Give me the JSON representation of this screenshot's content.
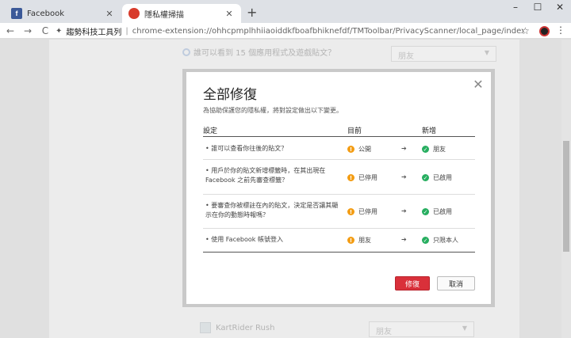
{
  "tabs": [
    {
      "label": "Facebook",
      "favicon": "f",
      "active": false
    },
    {
      "label": "隱私權掃描",
      "active": true
    }
  ],
  "window": {
    "minimize": "–",
    "maximize": "☐",
    "close": "✕"
  },
  "toolbar": {
    "back": "←",
    "forward": "→",
    "reload": "C",
    "extension_icon": "✦",
    "origin": "趨勢科技工具列",
    "separator": "|",
    "url": "chrome-extension://ohhcpmplhhiiaoiddkfboafbhiknefdf/TMToolbar/PrivacyScanner/local_page/index.html?locale=z...",
    "star": "☆",
    "menu": "⋮"
  },
  "background": {
    "row_text": "誰可以看到 15 個應用程式及遊戲貼文？",
    "select_value_top": "朋友",
    "game_name": "KartRider Rush",
    "select_value_bottom": "朋友",
    "select_arrow": "▼"
  },
  "modal": {
    "close": "✕",
    "title": "全部修復",
    "description": "為協助保護您的隱私權，將對設定做出以下變更。",
    "headers": {
      "setting": "設定",
      "current": "目前",
      "new": "新增"
    },
    "rows": [
      {
        "setting": "誰可以查看你往後的貼文？",
        "current": "公開",
        "new": "朋友"
      },
      {
        "setting": "用戶於你的貼文新增標籤時，在其出現在 Facebook 之前先審查標籤？",
        "current": "已停用",
        "new": "已啟用"
      },
      {
        "setting": "要審查你被標註在內的貼文，決定是否讓其顯示在你的動態時報嗎？",
        "current": "已停用",
        "new": "已啟用"
      },
      {
        "setting": "使用 Facebook 帳號登入",
        "current": "朋友",
        "new": "只限本人"
      }
    ],
    "warn_symbol": "!",
    "ok_symbol": "✓",
    "arrow": "➔",
    "fix_button": "修復",
    "cancel_button": "取消"
  },
  "colors": {
    "accent": "#d9303a",
    "warn": "#f39c12",
    "ok": "#27ae60"
  }
}
